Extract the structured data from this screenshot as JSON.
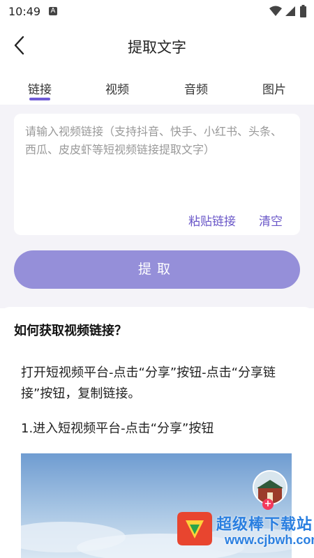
{
  "status_bar": {
    "time": "10:49",
    "a_badge": "A"
  },
  "header": {
    "title": "提取文字",
    "back_icon": "chevron-left-icon"
  },
  "tabs": [
    {
      "label": "链接",
      "active": true
    },
    {
      "label": "视频"
    },
    {
      "label": "音频"
    },
    {
      "label": "图片"
    }
  ],
  "input": {
    "placeholder": "请输入视频链接（支持抖音、快手、小红书、头条、西瓜、皮皮虾等短视频链接提取文字）",
    "value": "",
    "paste_label": "粘贴链接",
    "clear_label": "清空"
  },
  "extract_button": "提取",
  "guide": {
    "title": "如何获取视频链接？",
    "description": "打开短视频平台-点击“分享”按钮-点击“分享链接”按钮，复制链接。",
    "step1": "1.进入短视频平台-点击“分享”按钮"
  },
  "watermark": {
    "name": "超级棒下载站",
    "url": "www.cjbwh.com"
  },
  "colors": {
    "accent": "#6f5bd6",
    "button": "#958fd9",
    "background": "#f4f3f8"
  }
}
